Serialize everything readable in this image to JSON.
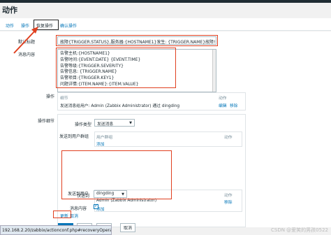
{
  "page": {
    "title": "动作"
  },
  "tabs": [
    {
      "label": "动作"
    },
    {
      "label": "操作"
    },
    {
      "label": "恢复操作"
    },
    {
      "label": "确认操作"
    }
  ],
  "form": {
    "subject_label": "默认标题",
    "subject_value": "故障{TRIGGER.STATUS},服务器:{HOSTNAME1}发生: {TRIGGER.NAME}故障!",
    "message_label": "消息内容",
    "message_lines": [
      "告警主机:{HOSTNAME1}",
      "告警时间:{EVENT.DATE} {EVENT.TIME}",
      "告警等级:{TRIGGER.SEVERITY}",
      "告警信息: {TRIGGER.NAME}",
      "告警项目:{TRIGGER.KEY1}",
      "问题详情:{ITEM.NAME}:{ITEM.VALUE}"
    ]
  },
  "operations": {
    "label": "操作",
    "col_details": "细节",
    "col_action": "动作",
    "row_details": "发送消息给用户: Admin (Zabbix Administrator) 通过 dingding",
    "edit": "编辑",
    "remove": "移除"
  },
  "op_details": {
    "label": "操作细节",
    "type_label": "操作类型",
    "type_value": "发送消息",
    "send_groups_label": "发送到用户群组",
    "group_col": "用户群组",
    "group_col_action": "动作",
    "group_add": "添加",
    "send_users_label": "发送到用户",
    "user_col": "用户",
    "user_col_action": "动作",
    "user_name": "Admin (Zabbix Administrator)",
    "user_remove": "移除",
    "user_add": "添加",
    "only_send_label": "仅送到",
    "only_send_value": "dingding",
    "default_msg_label": "消息内容",
    "update": "更新",
    "cancel": "取消"
  },
  "bottom_buttons": {
    "update": "更新",
    "clone": "克隆",
    "delete": "删除",
    "cancel": "取消"
  },
  "statusbar": "192.168.2.20/zabbix/actionconf.php#recoveryOperation7...",
  "watermark": "CSDN @爱笑的男孩0522",
  "colors": {
    "accent": "#0275b8",
    "highlight": "#e04020"
  }
}
